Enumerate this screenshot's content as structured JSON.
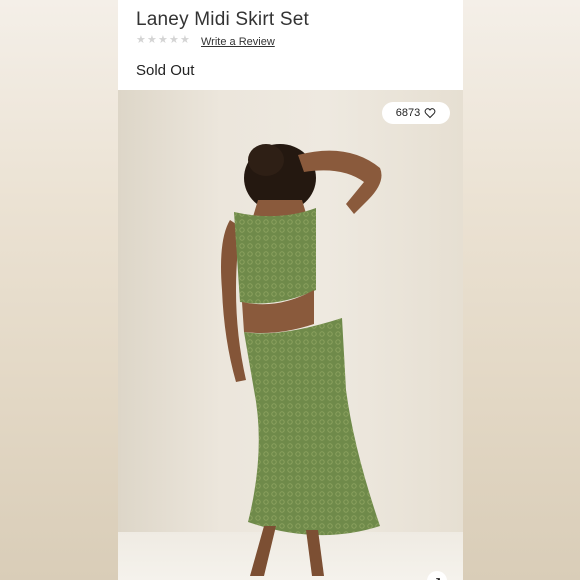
{
  "product": {
    "title": "Laney Midi Skirt Set",
    "rating_stars": 0,
    "review_link": "Write a Review",
    "stock_status": "Sold Out"
  },
  "likes": {
    "count": "6873",
    "icon": "heart-outline-icon"
  },
  "image": {
    "description_icon": "expand-icon",
    "outfit_color": "#6f8a4a",
    "skin_color": "#8a5a3c",
    "hair_color": "#2a1c14"
  }
}
